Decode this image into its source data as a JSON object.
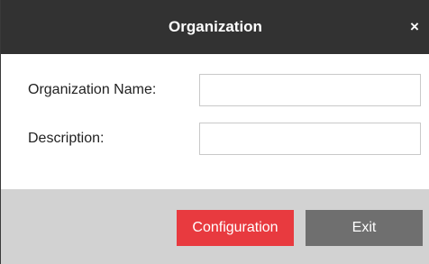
{
  "dialog": {
    "title": "Organization",
    "close_label": "×"
  },
  "form": {
    "name_label": "Organization Name:",
    "name_value": "",
    "description_label": "Description:",
    "description_value": ""
  },
  "footer": {
    "configuration_label": "Configuration",
    "exit_label": "Exit"
  },
  "colors": {
    "titlebar": "#323232",
    "footer": "#d2d2d2",
    "configuration_button": "#e83a3f",
    "exit_button": "#6f6f6f"
  }
}
